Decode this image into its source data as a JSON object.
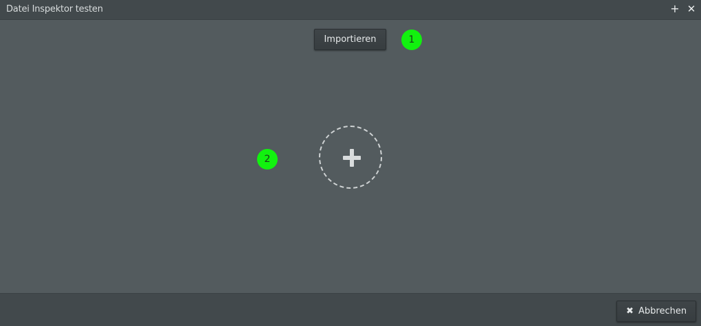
{
  "window": {
    "title": "Datei Inspektor testen",
    "add_icon": "+",
    "close_icon": "✕"
  },
  "main": {
    "import_label": "Importieren",
    "drop_zone_icon": "plus-icon"
  },
  "markers": [
    {
      "label": "1"
    },
    {
      "label": "2"
    }
  ],
  "footer": {
    "cancel_label": "Abbrechen",
    "cancel_icon": "✖"
  },
  "colors": {
    "background": "#535b5e",
    "titlebar": "#42494c",
    "marker": "#12f10f"
  }
}
